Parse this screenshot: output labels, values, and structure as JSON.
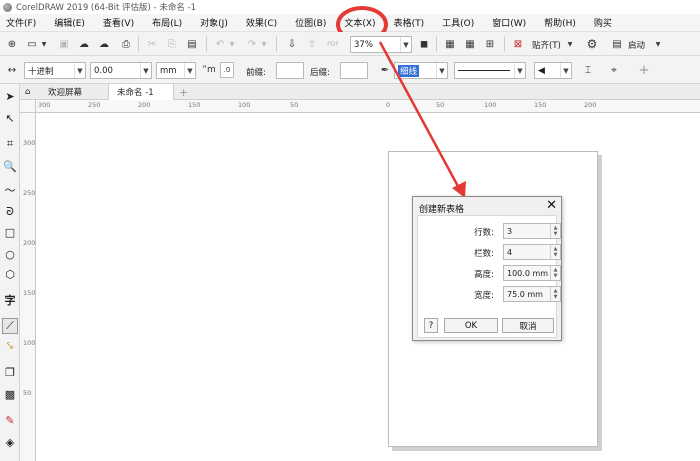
{
  "window": {
    "title": "CorelDRAW 2019 (64-Bit 评估版) - 未命名 -1"
  },
  "menu": [
    "文件(F)",
    "编辑(E)",
    "查看(V)",
    "布局(L)",
    "对象(J)",
    "效果(C)",
    "位图(B)",
    "文本(X)",
    "表格(T)",
    "工具(O)",
    "窗口(W)",
    "帮助(H)",
    "购买"
  ],
  "toolbar": {
    "zoom_value": "37%",
    "snap_label": "贴齐(T)",
    "launch_label": "启动"
  },
  "property_bar": {
    "unit_mode": "十进制",
    "value": "0.00",
    "unit": "mm",
    "prefix_label": "前缀:",
    "suffix_label": "后缀:",
    "outline_width": "细线"
  },
  "tabs": [
    "欢迎屏幕",
    "未命名 -1"
  ],
  "ruler": {
    "h_labels": [
      "300",
      "250",
      "200",
      "150",
      "100",
      "50",
      "0",
      "50",
      "100",
      "150",
      "200"
    ],
    "v_labels": [
      "300",
      "250",
      "200",
      "150",
      "100",
      "50"
    ]
  },
  "dialog": {
    "title": "创建新表格",
    "fields": [
      {
        "label": "行数:",
        "value": "3"
      },
      {
        "label": "栏数:",
        "value": "4"
      },
      {
        "label": "高度:",
        "value": "100.0 mm"
      },
      {
        "label": "宽度:",
        "value": "75.0 mm"
      }
    ],
    "help_label": "?",
    "ok_label": "OK",
    "cancel_label": "取消"
  },
  "colors": {
    "annotation": "#e53935"
  }
}
